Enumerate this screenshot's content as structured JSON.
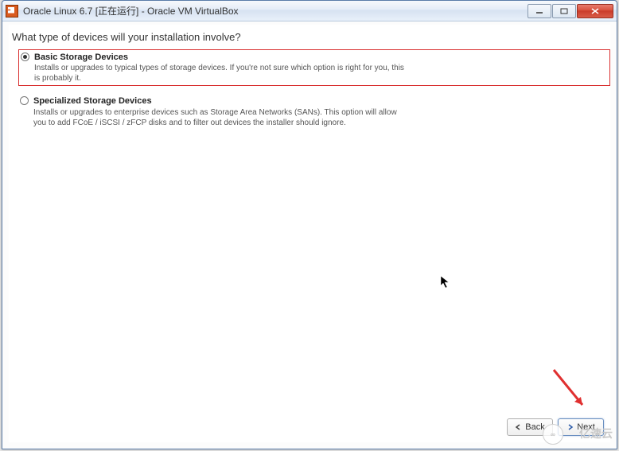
{
  "window": {
    "title": "Oracle Linux 6.7 [正在运行] - Oracle VM VirtualBox"
  },
  "installer": {
    "question": "What type of devices will your installation involve?",
    "options": [
      {
        "title": "Basic Storage Devices",
        "description": "Installs or upgrades to typical types of storage devices.  If you're not sure which option is right for you, this is probably it.",
        "selected": true,
        "highlighted": true
      },
      {
        "title": "Specialized Storage Devices",
        "description": "Installs or upgrades to enterprise devices such as Storage Area Networks (SANs). This option will allow you to add FCoE / iSCSI / zFCP disks and to filter out devices the installer should ignore.",
        "selected": false,
        "highlighted": false
      }
    ]
  },
  "footer": {
    "back_label": "Back",
    "next_label": "Next"
  },
  "watermark": {
    "text": "亿速云",
    "icon_label": "∞"
  }
}
